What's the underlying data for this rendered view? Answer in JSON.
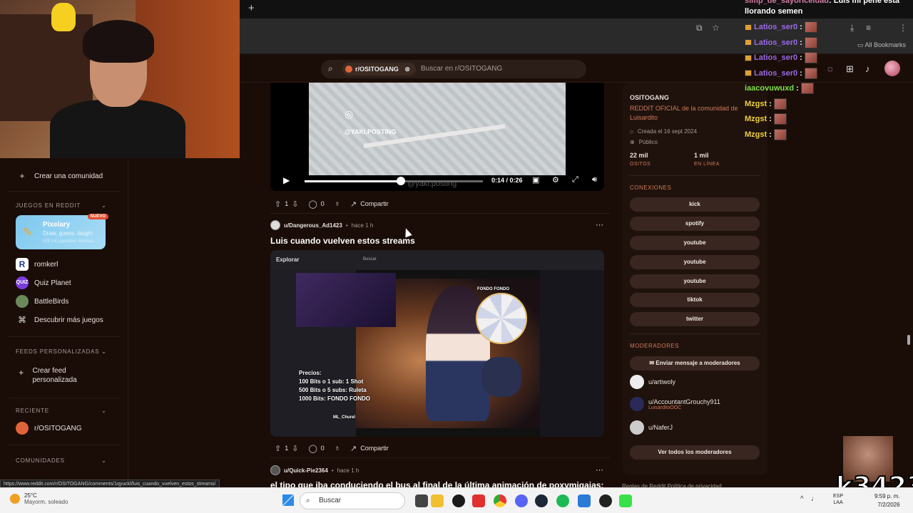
{
  "browser": {
    "new_tab_icon": "plus-icon",
    "bookmarks_label": "All Bookmarks"
  },
  "search": {
    "chip": "r/OSITOGANG",
    "placeholder": "Buscar en r/OSITOGANG"
  },
  "sidebar": {
    "create_community": "Crear una comunidad",
    "games_section": "JUEGOS EN REDDIT",
    "pixelary": {
      "title": "Pixelary",
      "desc": "Draw, guess, laugh!",
      "players": "529 mil jugadores mensua...",
      "badge": "NUEVO"
    },
    "games": [
      {
        "label": "romkerl"
      },
      {
        "label": "Quiz Planet"
      },
      {
        "label": "BattleBirds"
      },
      {
        "label": "Descubrir más juegos"
      }
    ],
    "feeds_section": "FEEDS PERSONALIZADAS",
    "create_feed": "Crear feed personalizada",
    "recent_section": "RECIENTE",
    "recent_item": "r/OSITOGANG",
    "communities_section": "COMUNIDADES"
  },
  "feed": {
    "video": {
      "watermark": "@YAKI.POSTING",
      "watermark2": "@yaki.posting",
      "time": "0:14 / 0:26",
      "progress": 0.54
    },
    "post1_actions": {
      "votes": "1",
      "comments": "0",
      "share": "Compartir"
    },
    "post2": {
      "user": "u/Dangerous_Ad1423",
      "time": "hace 1 h",
      "title": "Luis cuando vuelven estos streams",
      "image": {
        "explore": "Explorar",
        "search": "Buscar",
        "prices": "Precios:",
        "line1": "100 Bits o 1 sub: 1 Shot",
        "line2": "500 Bits o 5 subs: Ruleta",
        "line3": "1000 Bits: FONDO FONDO",
        "streamer": "ML_Churel",
        "fondo": "FONDO FONDO"
      },
      "actions": {
        "votes": "1",
        "comments": "0",
        "share": "Compartir"
      }
    },
    "post3": {
      "user": "u/Quick-Pie2364",
      "time": "hace 1 h",
      "title": "el tipo que iba conduciendo el bus al final de la última animación de poxymigajas:"
    }
  },
  "community": {
    "name": "OSITOGANG",
    "desc": "REDDIT OFICIAL de la comunidad de Luisardito",
    "created": "Creada el 16 sept 2024",
    "visibility": "Público",
    "members": "22 mil",
    "members_label": "OSITOS",
    "online": "1 mil",
    "online_label": "EN LÍNEA",
    "connections_title": "CONEXIONES",
    "connections": [
      "kick",
      "spotify",
      "youtube",
      "youtube",
      "youtube",
      "tiktok",
      "twitter"
    ],
    "mods_title": "MODERADORES",
    "message_mods": "Enviar mensaje a moderadores",
    "mods": [
      {
        "name": "u/artiwoly",
        "flair": ""
      },
      {
        "name": "u/AccountantGrouchy911",
        "flair": "LuisarditoOOC"
      },
      {
        "name": "u/NaferJ",
        "flair": ""
      }
    ],
    "all_mods": "Ver todos los moderadores",
    "footer": "Reglas de Reddit   Política de privacidad"
  },
  "chat": {
    "top_user": "simp_de_sayoriceldad",
    "top_msg": ": Luis mi pene esta llorando semen",
    "lines": [
      {
        "user": "Latios_ser0",
        "color": "#9a6ae6"
      },
      {
        "user": "Latios_ser0",
        "color": "#9a6ae6"
      },
      {
        "user": "Latios_ser0",
        "color": "#9a6ae6"
      },
      {
        "user": "Latios_ser0",
        "color": "#9a6ae6"
      },
      {
        "user": "iaacovuwuxd",
        "color": "#7ee04a"
      },
      {
        "user": "Mzgst",
        "color": "#f0d040"
      },
      {
        "user": "Mzgst",
        "color": "#f0d040"
      },
      {
        "user": "Mzgst",
        "color": "#f0d040"
      }
    ]
  },
  "overlay_text": "k3423",
  "status_url": "https://www.reddit.com/r/OSITOGANG/comments/1qyuckl/luis_cuando_vuelven_estos_streams/",
  "taskbar": {
    "temp": "25°C",
    "weather": "Mayorm. soleado",
    "search": "Buscar",
    "lang1": "ESP",
    "lang2": "LAA",
    "time": "9:59 p. m.",
    "date": "7/2/2026"
  }
}
